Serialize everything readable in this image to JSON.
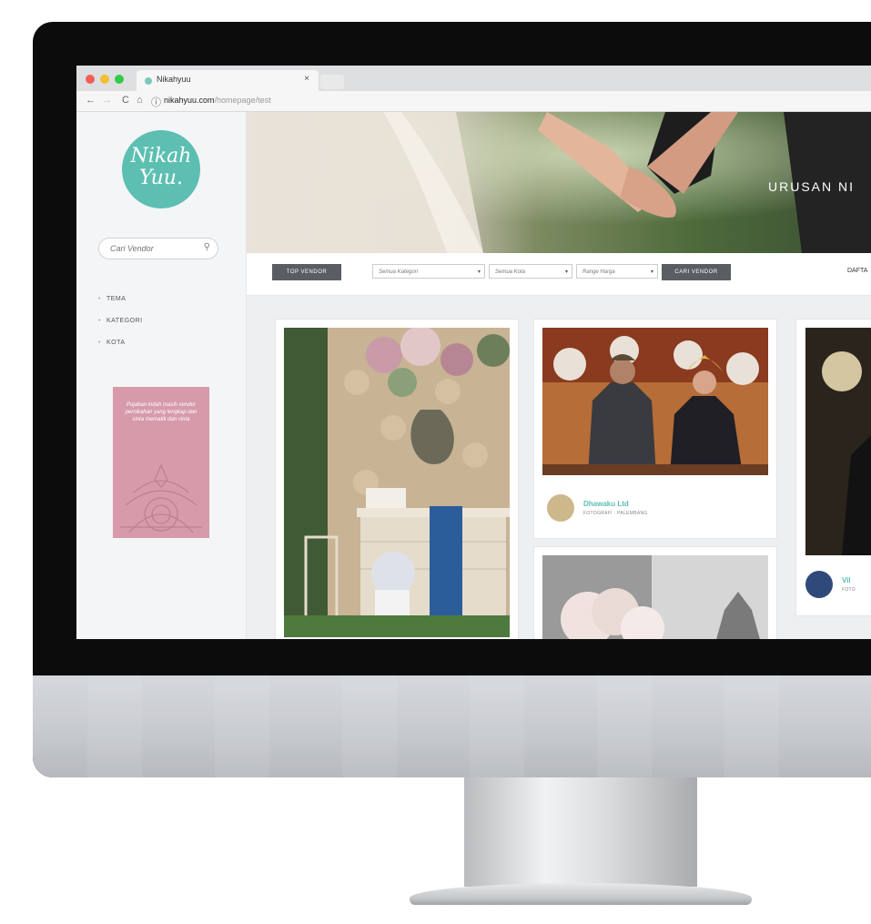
{
  "browser": {
    "tab_title": "Nikahyuu",
    "tab_close": "×",
    "url_domain": "nikahyuu.com",
    "url_path": "/homepage/test",
    "back": "←",
    "forward": "→",
    "reload": "C",
    "home": "⌂",
    "info": "ⓘ"
  },
  "sidebar": {
    "logo_line1": "Nikah",
    "logo_line2": "Yuu.",
    "search_placeholder": "Cari Vendor",
    "nav_items": [
      {
        "label": "TEMA"
      },
      {
        "label": "KATEGORI"
      },
      {
        "label": "KOTA"
      }
    ],
    "ad_text": "Pujaban indah masih vendor pernikahan yang lengkap dan cinta mematik dan cinta"
  },
  "hero": {
    "text": "URUSAN NI"
  },
  "filters": {
    "top_vendor": "TOP VENDOR",
    "kategori": "Semua Kategori",
    "kota": "Semua Kota",
    "harga": "Range Harga",
    "cari_vendor": "CARI VENDOR",
    "daftar": "DAFTA"
  },
  "cards": [
    {
      "vendor_name": "Dhawaku Ltd",
      "vendor_sub": "FOTOGRAFI · PALEMBANG"
    },
    {
      "vendor_name": "Vil",
      "vendor_sub": "FOTO"
    }
  ],
  "colors": {
    "brand": "#5cbfb1",
    "ad_pink": "#d69aaa",
    "button_dark": "#5a5d62"
  }
}
